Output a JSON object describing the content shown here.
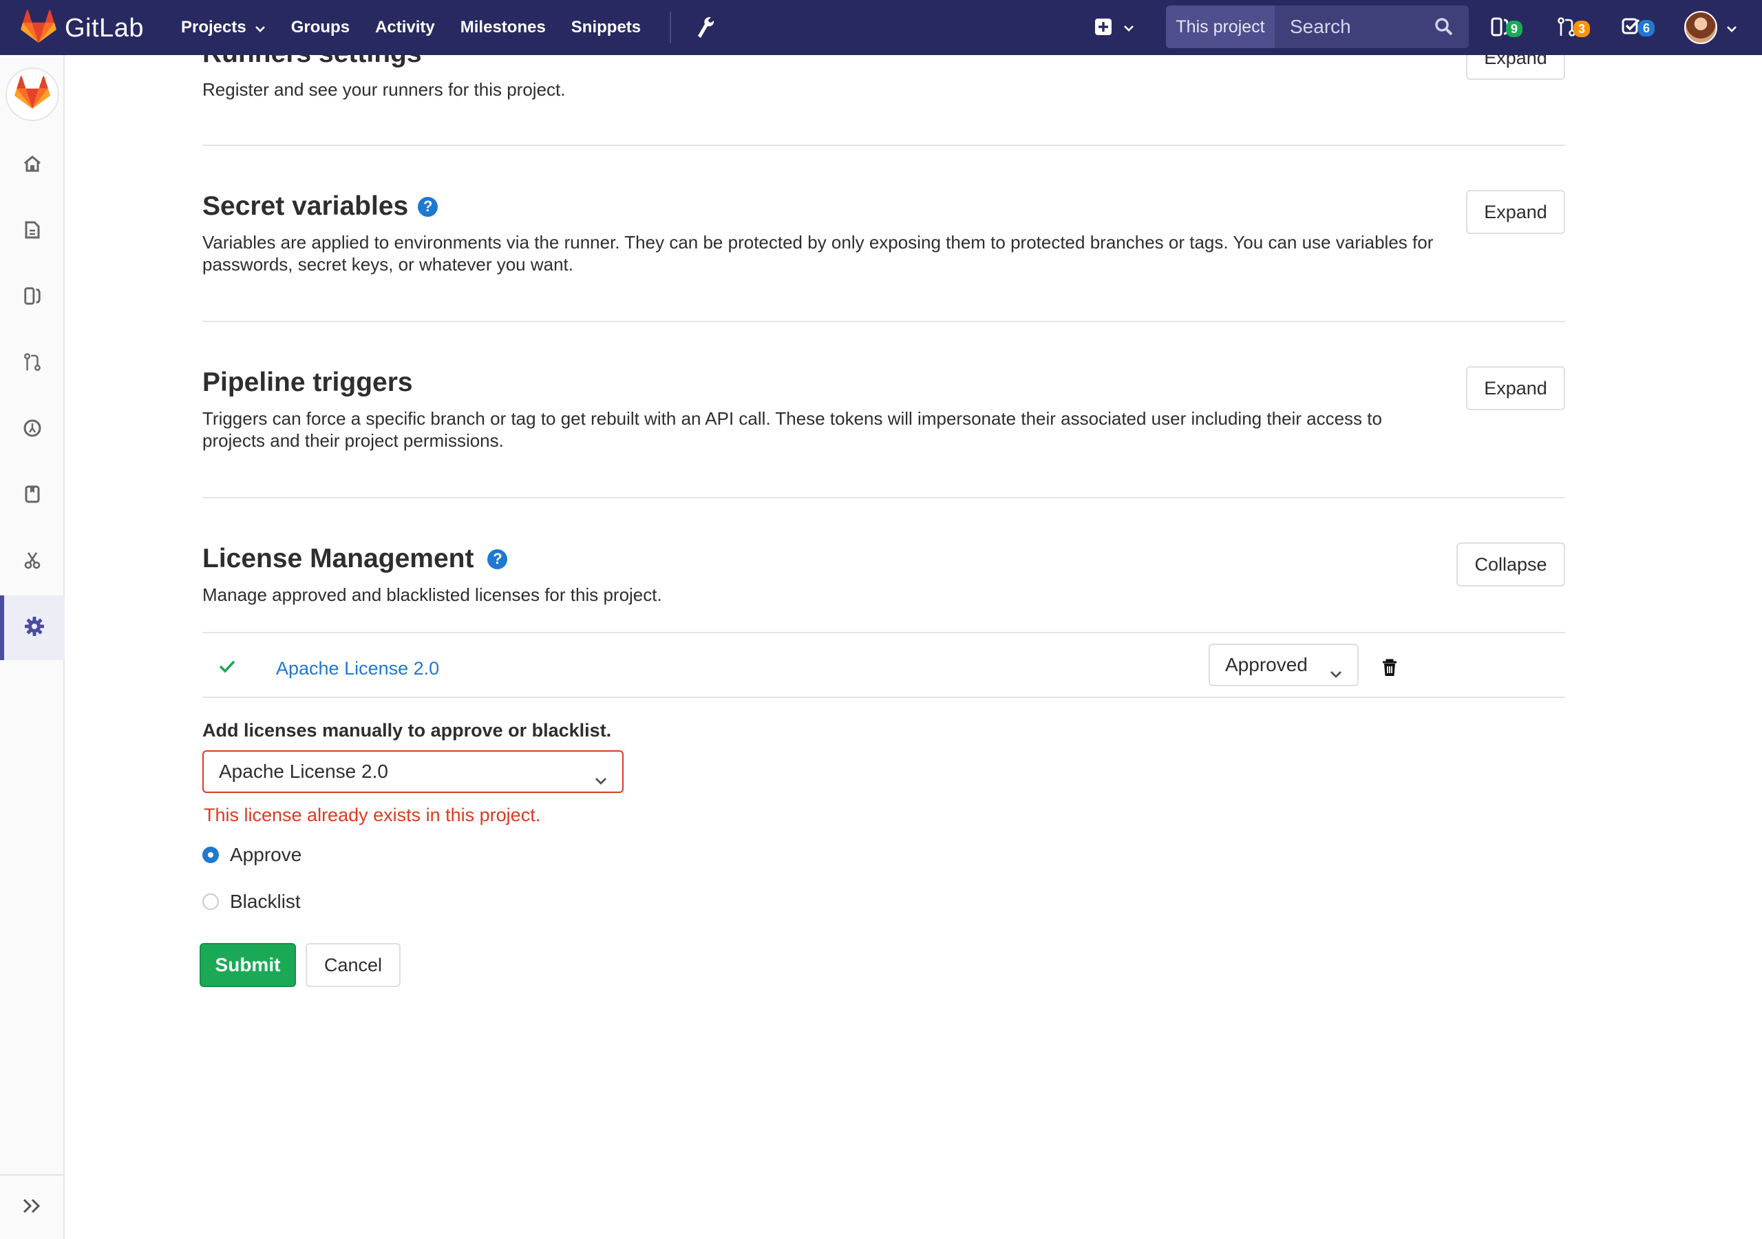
{
  "navbar": {
    "brand": "GitLab",
    "links": [
      "Projects",
      "Groups",
      "Activity",
      "Milestones",
      "Snippets"
    ],
    "search_scope": "This project",
    "search_placeholder": "Search",
    "counters": {
      "issues": "9",
      "merge_requests": "3",
      "todos": "6"
    },
    "colors": {
      "issues_badge": "#1aaa55",
      "merge_requests_badge": "#fc9403",
      "todos_badge": "#1f78d1"
    }
  },
  "sidebar": {
    "items": [
      "home-icon",
      "repository-icon",
      "issues-icon",
      "merge-requests-icon",
      "ci-cd-icon",
      "wiki-icon",
      "snippets-icon",
      "settings-icon"
    ],
    "active": "settings-icon"
  },
  "sections": {
    "runners": {
      "title": "Runners settings",
      "description": "Register and see your runners for this project.",
      "button": "Expand"
    },
    "secret_variables": {
      "title": "Secret variables",
      "description": "Variables are applied to environments via the runner. They can be protected by only exposing them to protected branches or tags. You can use variables for passwords, secret keys, or whatever you want.",
      "button": "Expand"
    },
    "pipeline_triggers": {
      "title": "Pipeline triggers",
      "description": "Triggers can force a specific branch or tag to get rebuilt with an API call. These tokens will impersonate their associated user including their access to projects and their project permissions.",
      "button": "Expand"
    },
    "license_management": {
      "title": "License Management",
      "description": "Manage approved and blacklisted licenses for this project.",
      "button": "Collapse",
      "licenses": [
        {
          "name": "Apache License 2.0",
          "status": "Approved"
        }
      ],
      "form": {
        "label": "Add licenses manually to approve or blacklist.",
        "selected_license": "Apache License 2.0",
        "error": "This license already exists in this project.",
        "options": [
          {
            "label": "Approve",
            "checked": true
          },
          {
            "label": "Blacklist",
            "checked": false
          }
        ],
        "submit": "Submit",
        "cancel": "Cancel"
      }
    }
  }
}
